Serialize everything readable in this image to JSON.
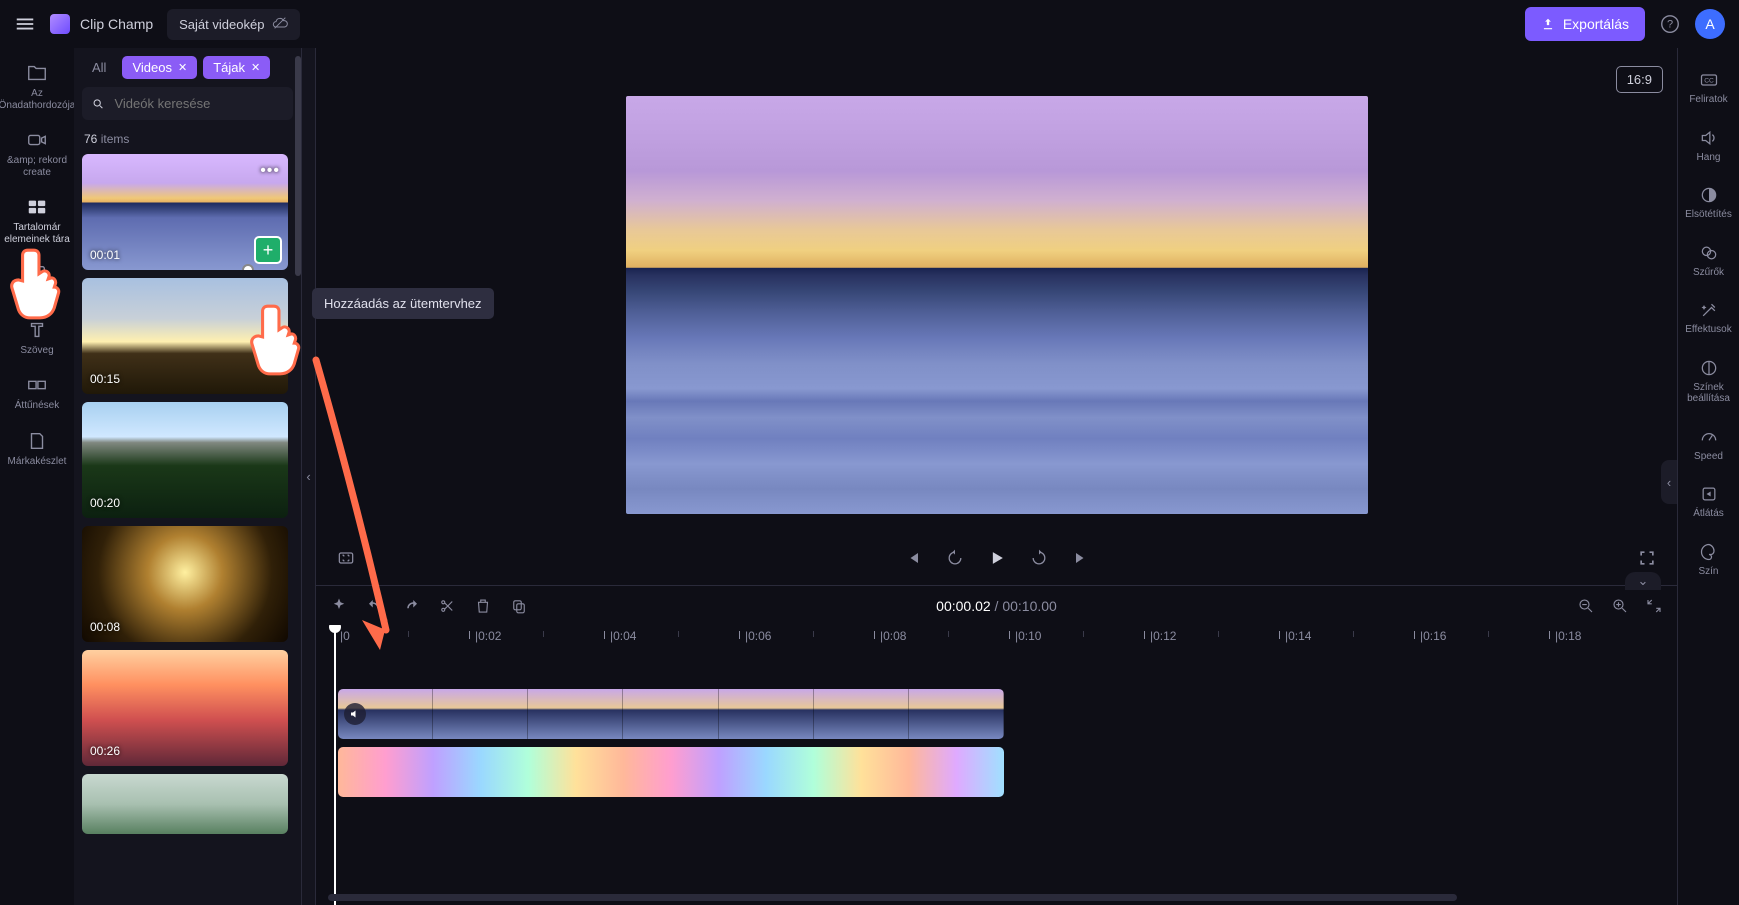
{
  "app": {
    "name": "Clip Champ",
    "project": "Saját videokép",
    "avatar_letter": "A"
  },
  "header": {
    "export": "Exportálás",
    "aspect": "16:9"
  },
  "left_rail": {
    "media": {
      "label": "Az Önadathordozója"
    },
    "record": {
      "label": "&amp; rekord create"
    },
    "content": {
      "label": "Tartalomár elemeinek tára"
    },
    "templates": {
      "label": "—"
    },
    "text": {
      "label": "Szöveg"
    },
    "transitions": {
      "label": "Áttűnések"
    },
    "brand": {
      "label": "Márkakészlet"
    }
  },
  "library": {
    "chips": {
      "all": "All",
      "videos": "Videos",
      "tajak": "Tájak"
    },
    "search_placeholder": "Videók keresése",
    "count_num": "76",
    "count_word": "items",
    "items": [
      {
        "dur": "00:01"
      },
      {
        "dur": "00:15"
      },
      {
        "dur": "00:20"
      },
      {
        "dur": "00:08"
      },
      {
        "dur": "00:26"
      },
      {
        "dur": ""
      }
    ]
  },
  "tooltip": {
    "add_to_timeline": "Hozzáadás az ütemtervhez"
  },
  "transport": {
    "current": "00:00.02",
    "total": "00:10.00"
  },
  "ruler": {
    "labels": [
      "0",
      "0:02",
      "0:04",
      "0:06",
      "0:08",
      "0:10",
      "0:12",
      "0:14",
      "0:16",
      "0:18"
    ]
  },
  "right_rail": {
    "captions": {
      "label": "Feliratok"
    },
    "audio": {
      "label": "Hang"
    },
    "fade": {
      "label": "Elsötétítés"
    },
    "filters": {
      "label": "Szűrők"
    },
    "effects": {
      "label": "Effektusok"
    },
    "colors": {
      "label": "Színek beállítása"
    },
    "speed": {
      "label": "Speed"
    },
    "crop": {
      "label": "Átlátás"
    },
    "color": {
      "label": "Szín"
    }
  }
}
